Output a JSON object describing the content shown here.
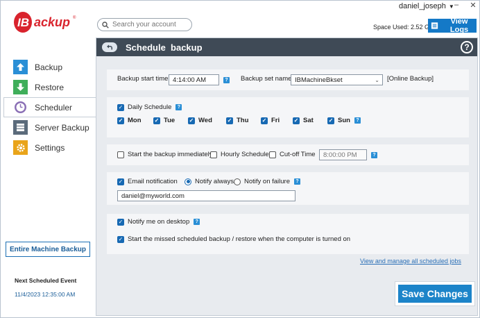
{
  "topbar": {
    "username": "daniel_joseph",
    "space_used": "Space Used: 2.52 GB",
    "view_logs": "View Logs",
    "search_placeholder": "Search your account"
  },
  "logo": {
    "text": "IBackup",
    "reg": "®"
  },
  "sidebar": {
    "items": [
      {
        "label": "Backup"
      },
      {
        "label": "Restore"
      },
      {
        "label": "Scheduler"
      },
      {
        "label": "Server Backup"
      },
      {
        "label": "Settings"
      }
    ],
    "entire_machine_backup": "Entire Machine Backup",
    "next_event_label": "Next Scheduled Event",
    "next_event_value": "11/4/2023 12:35:00 AM"
  },
  "panel": {
    "title": "Schedule  backup",
    "help": "?",
    "start_time_label": "Backup start time:",
    "start_time_value": "4:14:00 AM",
    "set_name_label": "Backup set name",
    "set_name_value": "IBMachineBkset",
    "set_type": "[Online Backup]",
    "daily_schedule": "Daily Schedule",
    "days": [
      "Mon",
      "Tue",
      "Wed",
      "Thu",
      "Fri",
      "Sat",
      "Sun"
    ],
    "start_immediately": "Start the backup immediately",
    "hourly_schedule": "Hourly Schedule",
    "cutoff_time": "Cut-off Time",
    "cutoff_value": "8:00:00 PM",
    "email_notification": "Email notification",
    "notify_always": "Notify always",
    "notify_failure": "Notify on failure",
    "email_value": "daniel@myworld.com",
    "notify_desktop": "Notify me on desktop",
    "missed_backup": "Start the missed scheduled backup / restore when the computer is turned on",
    "view_link": "View and manage all scheduled jobs",
    "save": "Save Changes"
  },
  "colors": {
    "accent": "#1c84c9",
    "header": "#3f4a56",
    "logo_red": "#d9232d"
  }
}
